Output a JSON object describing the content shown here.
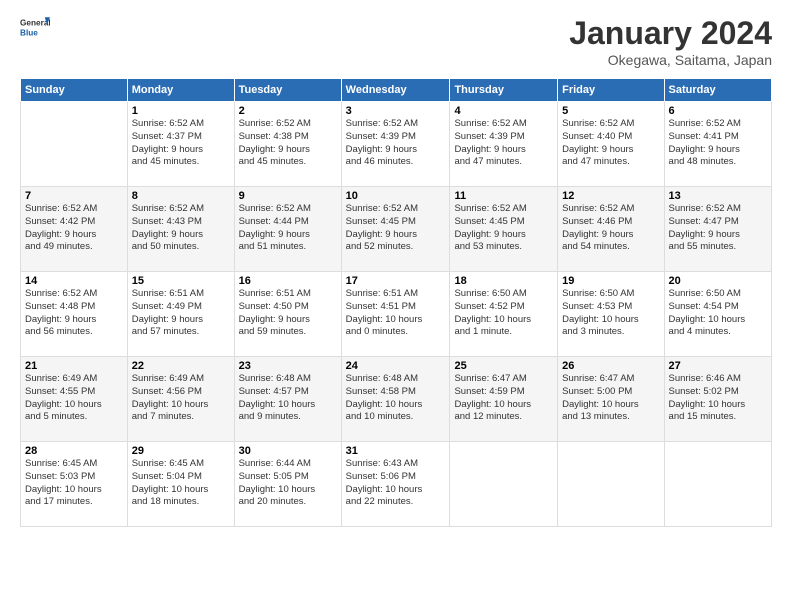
{
  "logo": {
    "line1": "General",
    "line2": "Blue"
  },
  "title": "January 2024",
  "location": "Okegawa, Saitama, Japan",
  "days_header": [
    "Sunday",
    "Monday",
    "Tuesday",
    "Wednesday",
    "Thursday",
    "Friday",
    "Saturday"
  ],
  "weeks": [
    [
      {
        "num": "",
        "info": ""
      },
      {
        "num": "1",
        "info": "Sunrise: 6:52 AM\nSunset: 4:37 PM\nDaylight: 9 hours\nand 45 minutes."
      },
      {
        "num": "2",
        "info": "Sunrise: 6:52 AM\nSunset: 4:38 PM\nDaylight: 9 hours\nand 45 minutes."
      },
      {
        "num": "3",
        "info": "Sunrise: 6:52 AM\nSunset: 4:39 PM\nDaylight: 9 hours\nand 46 minutes."
      },
      {
        "num": "4",
        "info": "Sunrise: 6:52 AM\nSunset: 4:39 PM\nDaylight: 9 hours\nand 47 minutes."
      },
      {
        "num": "5",
        "info": "Sunrise: 6:52 AM\nSunset: 4:40 PM\nDaylight: 9 hours\nand 47 minutes."
      },
      {
        "num": "6",
        "info": "Sunrise: 6:52 AM\nSunset: 4:41 PM\nDaylight: 9 hours\nand 48 minutes."
      }
    ],
    [
      {
        "num": "7",
        "info": "Sunrise: 6:52 AM\nSunset: 4:42 PM\nDaylight: 9 hours\nand 49 minutes."
      },
      {
        "num": "8",
        "info": "Sunrise: 6:52 AM\nSunset: 4:43 PM\nDaylight: 9 hours\nand 50 minutes."
      },
      {
        "num": "9",
        "info": "Sunrise: 6:52 AM\nSunset: 4:44 PM\nDaylight: 9 hours\nand 51 minutes."
      },
      {
        "num": "10",
        "info": "Sunrise: 6:52 AM\nSunset: 4:45 PM\nDaylight: 9 hours\nand 52 minutes."
      },
      {
        "num": "11",
        "info": "Sunrise: 6:52 AM\nSunset: 4:45 PM\nDaylight: 9 hours\nand 53 minutes."
      },
      {
        "num": "12",
        "info": "Sunrise: 6:52 AM\nSunset: 4:46 PM\nDaylight: 9 hours\nand 54 minutes."
      },
      {
        "num": "13",
        "info": "Sunrise: 6:52 AM\nSunset: 4:47 PM\nDaylight: 9 hours\nand 55 minutes."
      }
    ],
    [
      {
        "num": "14",
        "info": "Sunrise: 6:52 AM\nSunset: 4:48 PM\nDaylight: 9 hours\nand 56 minutes."
      },
      {
        "num": "15",
        "info": "Sunrise: 6:51 AM\nSunset: 4:49 PM\nDaylight: 9 hours\nand 57 minutes."
      },
      {
        "num": "16",
        "info": "Sunrise: 6:51 AM\nSunset: 4:50 PM\nDaylight: 9 hours\nand 59 minutes."
      },
      {
        "num": "17",
        "info": "Sunrise: 6:51 AM\nSunset: 4:51 PM\nDaylight: 10 hours\nand 0 minutes."
      },
      {
        "num": "18",
        "info": "Sunrise: 6:50 AM\nSunset: 4:52 PM\nDaylight: 10 hours\nand 1 minute."
      },
      {
        "num": "19",
        "info": "Sunrise: 6:50 AM\nSunset: 4:53 PM\nDaylight: 10 hours\nand 3 minutes."
      },
      {
        "num": "20",
        "info": "Sunrise: 6:50 AM\nSunset: 4:54 PM\nDaylight: 10 hours\nand 4 minutes."
      }
    ],
    [
      {
        "num": "21",
        "info": "Sunrise: 6:49 AM\nSunset: 4:55 PM\nDaylight: 10 hours\nand 5 minutes."
      },
      {
        "num": "22",
        "info": "Sunrise: 6:49 AM\nSunset: 4:56 PM\nDaylight: 10 hours\nand 7 minutes."
      },
      {
        "num": "23",
        "info": "Sunrise: 6:48 AM\nSunset: 4:57 PM\nDaylight: 10 hours\nand 9 minutes."
      },
      {
        "num": "24",
        "info": "Sunrise: 6:48 AM\nSunset: 4:58 PM\nDaylight: 10 hours\nand 10 minutes."
      },
      {
        "num": "25",
        "info": "Sunrise: 6:47 AM\nSunset: 4:59 PM\nDaylight: 10 hours\nand 12 minutes."
      },
      {
        "num": "26",
        "info": "Sunrise: 6:47 AM\nSunset: 5:00 PM\nDaylight: 10 hours\nand 13 minutes."
      },
      {
        "num": "27",
        "info": "Sunrise: 6:46 AM\nSunset: 5:02 PM\nDaylight: 10 hours\nand 15 minutes."
      }
    ],
    [
      {
        "num": "28",
        "info": "Sunrise: 6:45 AM\nSunset: 5:03 PM\nDaylight: 10 hours\nand 17 minutes."
      },
      {
        "num": "29",
        "info": "Sunrise: 6:45 AM\nSunset: 5:04 PM\nDaylight: 10 hours\nand 18 minutes."
      },
      {
        "num": "30",
        "info": "Sunrise: 6:44 AM\nSunset: 5:05 PM\nDaylight: 10 hours\nand 20 minutes."
      },
      {
        "num": "31",
        "info": "Sunrise: 6:43 AM\nSunset: 5:06 PM\nDaylight: 10 hours\nand 22 minutes."
      },
      {
        "num": "",
        "info": ""
      },
      {
        "num": "",
        "info": ""
      },
      {
        "num": "",
        "info": ""
      }
    ]
  ]
}
